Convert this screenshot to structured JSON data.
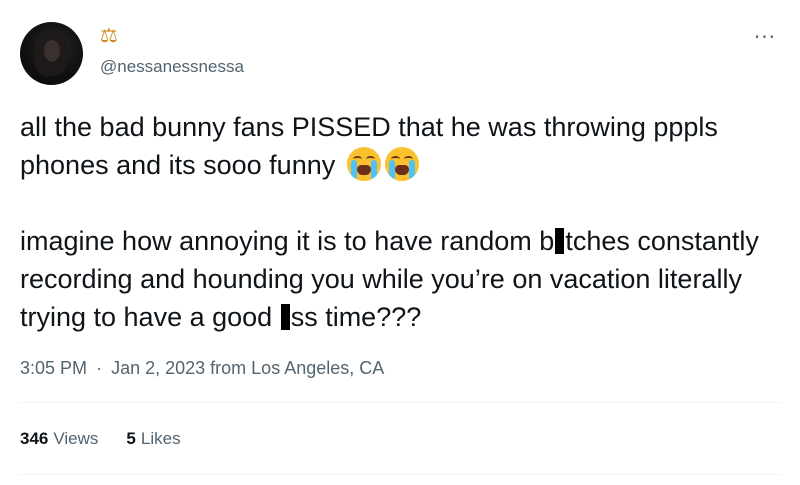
{
  "author": {
    "badge_icon": "scales-icon",
    "badge_glyph": "⚖",
    "badge_color": "#d08a1a",
    "handle": "@nessanessnessa"
  },
  "menu": {
    "more_glyph": "···"
  },
  "tweet": {
    "line1_a": "all the bad bunny fans PISSED that he was throwing pppls phones and its sooo funny",
    "emojis": [
      "loudly-crying-face-emoji",
      "loudly-crying-face-emoji"
    ],
    "p2_a": "imagine how annoying it is to have random b",
    "p2_b": "tches constantly recording and hounding you while you’re on vacation literally trying to have a good ",
    "p2_c": "ss time???"
  },
  "meta": {
    "time": "3:05 PM",
    "separator": "·",
    "date": "Jan 2, 2023",
    "location": "from Los Angeles, CA"
  },
  "stats": {
    "views_count": "346",
    "views_label": "Views",
    "likes_count": "5",
    "likes_label": "Likes"
  },
  "colors": {
    "text": "#0f1419",
    "secondary": "#536471",
    "divider": "#eff3f4"
  }
}
